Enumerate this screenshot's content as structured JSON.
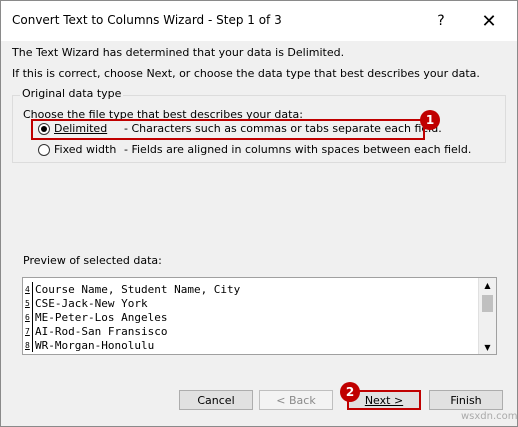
{
  "window": {
    "title": "Convert Text to Columns Wizard - Step 1 of 3",
    "help_glyph": "?",
    "close_glyph": "✕"
  },
  "intro": {
    "line1": "The Text Wizard has determined that your data is Delimited.",
    "line2": "If this is correct, choose Next, or choose the data type that best describes your data."
  },
  "original_data_type": {
    "group_label": "Original data type",
    "choose_label": "Choose the file type that best describes your data:",
    "options": [
      {
        "label": "Delimited",
        "description": "- Characters such as commas or tabs separate each field.",
        "selected": true
      },
      {
        "label": "Fixed width",
        "description": "- Fields are aligned in columns with spaces between each field.",
        "selected": false
      }
    ]
  },
  "badges": [
    "1",
    "2"
  ],
  "preview": {
    "label": "Preview of selected data:",
    "rows": [
      {
        "num": "4",
        "text": "Course Name, Student Name, City"
      },
      {
        "num": "5",
        "text": "CSE-Jack-New York"
      },
      {
        "num": "6",
        "text": "ME-Peter-Los Angeles"
      },
      {
        "num": "7",
        "text": "AI-Rod-San Fransisco"
      },
      {
        "num": "8",
        "text": "WR-Morgan-Honolulu"
      }
    ]
  },
  "buttons": {
    "cancel": "Cancel",
    "back": "< Back",
    "next": "Next >",
    "finish": "Finish"
  },
  "watermark": "wsxdn.com",
  "colors": {
    "highlight": "#c00000",
    "dialog_bg": "#f0f0f0"
  }
}
